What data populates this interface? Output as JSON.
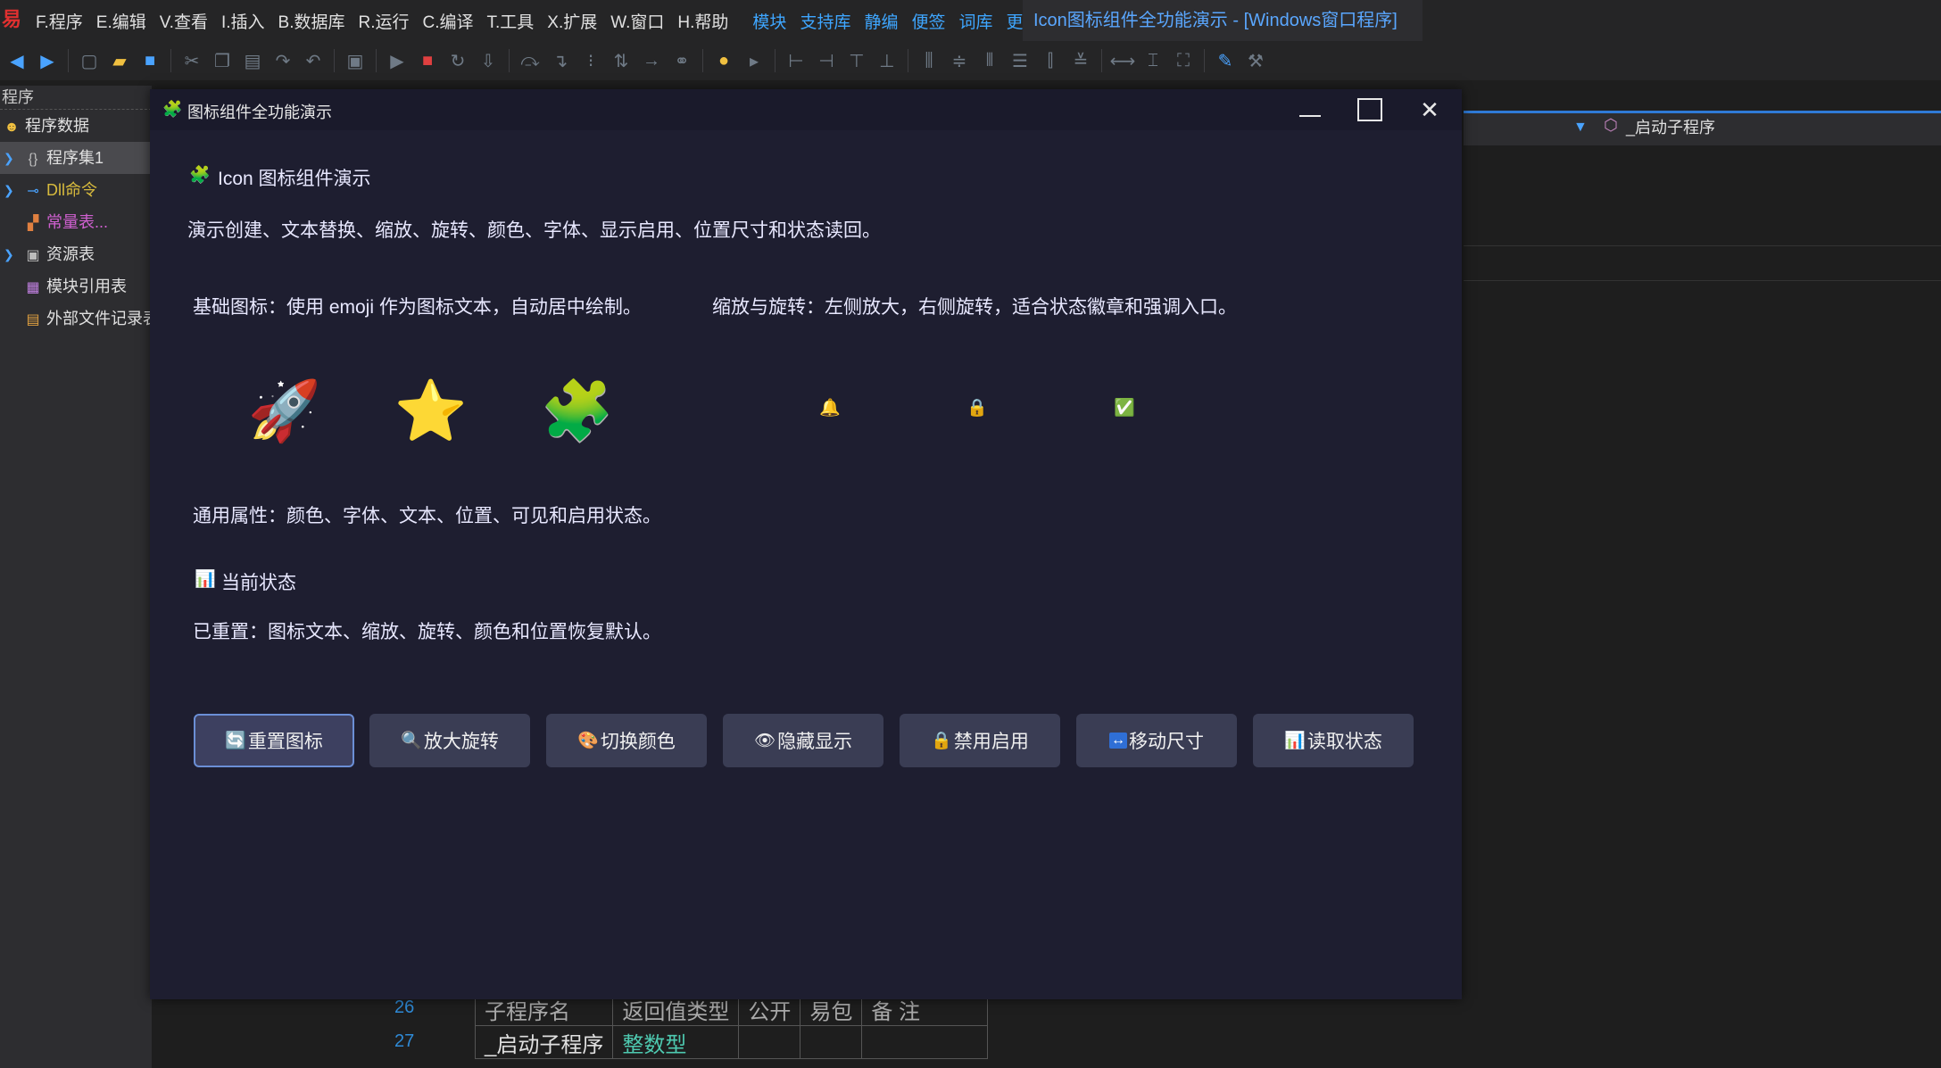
{
  "ide": {
    "logo": "易",
    "menu": [
      "F.程序",
      "E.编辑",
      "V.查看",
      "I.插入",
      "B.数据库",
      "R.运行",
      "C.编译",
      "T.工具",
      "X.扩展",
      "W.窗口",
      "H.帮助"
    ],
    "quick_links": [
      "模块",
      "支持库",
      "静编",
      "便签",
      "词库",
      "更多"
    ],
    "title": "Icon图标组件全功能演示 - [Windows窗口程序]",
    "left_panel": {
      "header": "程序",
      "items": [
        {
          "label": "程序数据",
          "icon": "smiley-icon"
        },
        {
          "label": "程序集1",
          "icon": "braces-icon"
        },
        {
          "label": "Dll命令",
          "icon": "plug-icon"
        },
        {
          "label": "常量表...",
          "icon": "constant-icon"
        },
        {
          "label": "资源表",
          "icon": "resource-icon"
        },
        {
          "label": "模块引用表",
          "icon": "module-icon"
        },
        {
          "label": "外部文件记录表",
          "icon": "file-record-icon"
        }
      ]
    },
    "editor": {
      "sub_program_selector": "_启动子程序",
      "line_numbers": [
        "26",
        "27"
      ],
      "table_headers": [
        "子程序名",
        "返回值类型",
        "公开",
        "易包",
        "备 注"
      ],
      "table_row": [
        "_启动子程序",
        "整数型",
        "",
        "",
        ""
      ]
    }
  },
  "window": {
    "title_icon": "🧩",
    "title": "图标组件全功能演示",
    "heading_icon": "🧩",
    "heading": "Icon 图标组件演示",
    "description": "演示创建、文本替换、缩放、旋转、颜色、字体、显示启用、位置尺寸和状态读回。",
    "basic_label": "基础图标：使用 emoji 作为图标文本，自动居中绘制。",
    "scale_label": "缩放与旋转：左侧放大，右侧旋转，适合状态徽章和强调入口。",
    "basic_icons": [
      {
        "glyph": "🚀",
        "name": "rocket-icon"
      },
      {
        "glyph": "⭐",
        "name": "star-icon"
      },
      {
        "glyph": "🧩",
        "name": "puzzle-icon"
      }
    ],
    "scale_icons": [
      {
        "glyph": "🔔",
        "name": "bell-icon"
      },
      {
        "glyph": "🔒",
        "name": "lock-icon"
      },
      {
        "glyph": "✅",
        "name": "check-icon"
      }
    ],
    "common_props": "通用属性：颜色、字体、文本、位置、可见和启用状态。",
    "status_icon": "📊",
    "status_heading": "当前状态",
    "status_text": "已重置：图标文本、缩放、旋转、颜色和位置恢复默认。",
    "buttons": [
      {
        "emoji": "🔄",
        "label": "重置图标"
      },
      {
        "emoji": "🔍",
        "label": "放大旋转"
      },
      {
        "emoji": "🎨",
        "label": "切换颜色"
      },
      {
        "emoji": "👁",
        "label": "隐藏显示"
      },
      {
        "emoji": "🔒",
        "label": "禁用启用"
      },
      {
        "emoji": "↔",
        "label": "移动尺寸"
      },
      {
        "emoji": "📊",
        "label": "读取状态"
      }
    ]
  }
}
